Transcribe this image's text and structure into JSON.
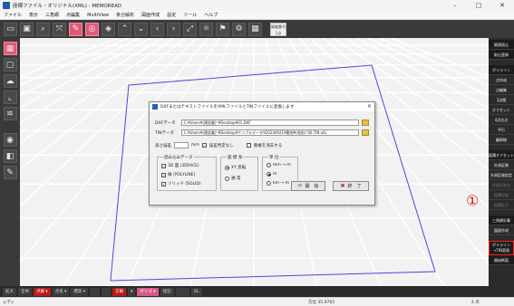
{
  "window": {
    "title": "座標ファイル・オリジナル(XML) - MEMOREAD",
    "minimize": "–",
    "maximize": "□",
    "close": "✕"
  },
  "menu": [
    "ファイル",
    "表示",
    "三角網",
    "点編集",
    "MultiView",
    "条分解析",
    "図面作成",
    "設定",
    "ツール",
    "ヘルプ"
  ],
  "toolbar": {
    "badge_line1": "調査番号",
    "badge_line2": "1点"
  },
  "right_panel": {
    "items": [
      {
        "label": "観測読込",
        "style": "header"
      },
      {
        "label": "取込登録",
        "style": "header"
      },
      {
        "label": "ポリライン",
        "style": "header"
      },
      {
        "label": "点作成",
        "style": "normal"
      },
      {
        "label": "点編集",
        "style": "normal"
      },
      {
        "label": "3点間",
        "style": "normal"
      },
      {
        "label": "オフセット",
        "style": "normal"
      },
      {
        "label": "4点交点",
        "style": "normal"
      },
      {
        "label": "平行",
        "style": "normal"
      },
      {
        "label": "輪郭線",
        "style": "normal"
      },
      {
        "label": "面積オフセット",
        "style": "header"
      },
      {
        "label": "外周区線",
        "style": "normal"
      },
      {
        "label": "外周区線設定",
        "style": "normal"
      },
      {
        "label": "外周区線分",
        "style": "dim"
      },
      {
        "label": "面積比較",
        "style": "dim"
      },
      {
        "label": "面積区分",
        "style": "dim"
      },
      {
        "label": "三角網計算",
        "style": "header"
      },
      {
        "label": "図面作成",
        "style": "normal"
      }
    ],
    "highlighted_line1": "ポリライン",
    "highlighted_line2": "→TIN変換",
    "last_item": "開始断面"
  },
  "annotation": "①",
  "bottom_bar": {
    "buttons": [
      {
        "label": "拡大",
        "style": "normal"
      },
      {
        "label": "全体",
        "style": "normal"
      },
      {
        "label": "点群 ▾",
        "style": "red"
      },
      {
        "label": "点名 ▾",
        "style": "normal"
      },
      {
        "label": "標高 ▾",
        "style": "normal"
      },
      {
        "label": "　",
        "style": "normal"
      },
      {
        "label": "　",
        "style": "normal"
      },
      {
        "label": "方眼",
        "style": "red"
      },
      {
        "label": "▾",
        "style": "normal"
      },
      {
        "label": "ポリゴ ▾",
        "style": "pink"
      },
      {
        "label": "径記",
        "style": "normal"
      },
      {
        "label": "　　",
        "style": "normal"
      },
      {
        "label": "GL",
        "style": "normal"
      }
    ]
  },
  "status_bar": {
    "left": "レディ",
    "middle": "方位 35.9793",
    "right": "4 点"
  },
  "dialog": {
    "title": "DXFまたはテキストファイルをXMLファイルとTINファイルに変換します",
    "close": "✕",
    "dxf_label": "DXFデータ",
    "dxf_path": "C:¥Users¥(建設業)⁺¥Desktop¥01.DXF",
    "tin_label": "TINデータ",
    "tin_path": "C:¥Users¥(建設業)⁺¥Desktop¥サンプルデータ¥20230921¥敷地¥(地形)⁺00.TIN.xlG",
    "height_diff_label": "高さ誤差",
    "height_unit": "mm",
    "height_judge_label": "誤差判定なし",
    "overwrite_label": "重複を消去する",
    "group_read": "読み込みデータ",
    "read_3dface": "3D 面 (3DFACE)",
    "read_polyline": "線 (POLYLINE)",
    "read_solid": "ソリッド (SOLID)",
    "group_coord": "座 標 系",
    "coord_xy": "XY 反転",
    "coord_normal": "通 常",
    "group_unit": "単 位",
    "unit_mm": "mm → m",
    "unit_m": "m",
    "unit_km": "km → m",
    "start_button": "開　始",
    "end_button": "終　了"
  }
}
